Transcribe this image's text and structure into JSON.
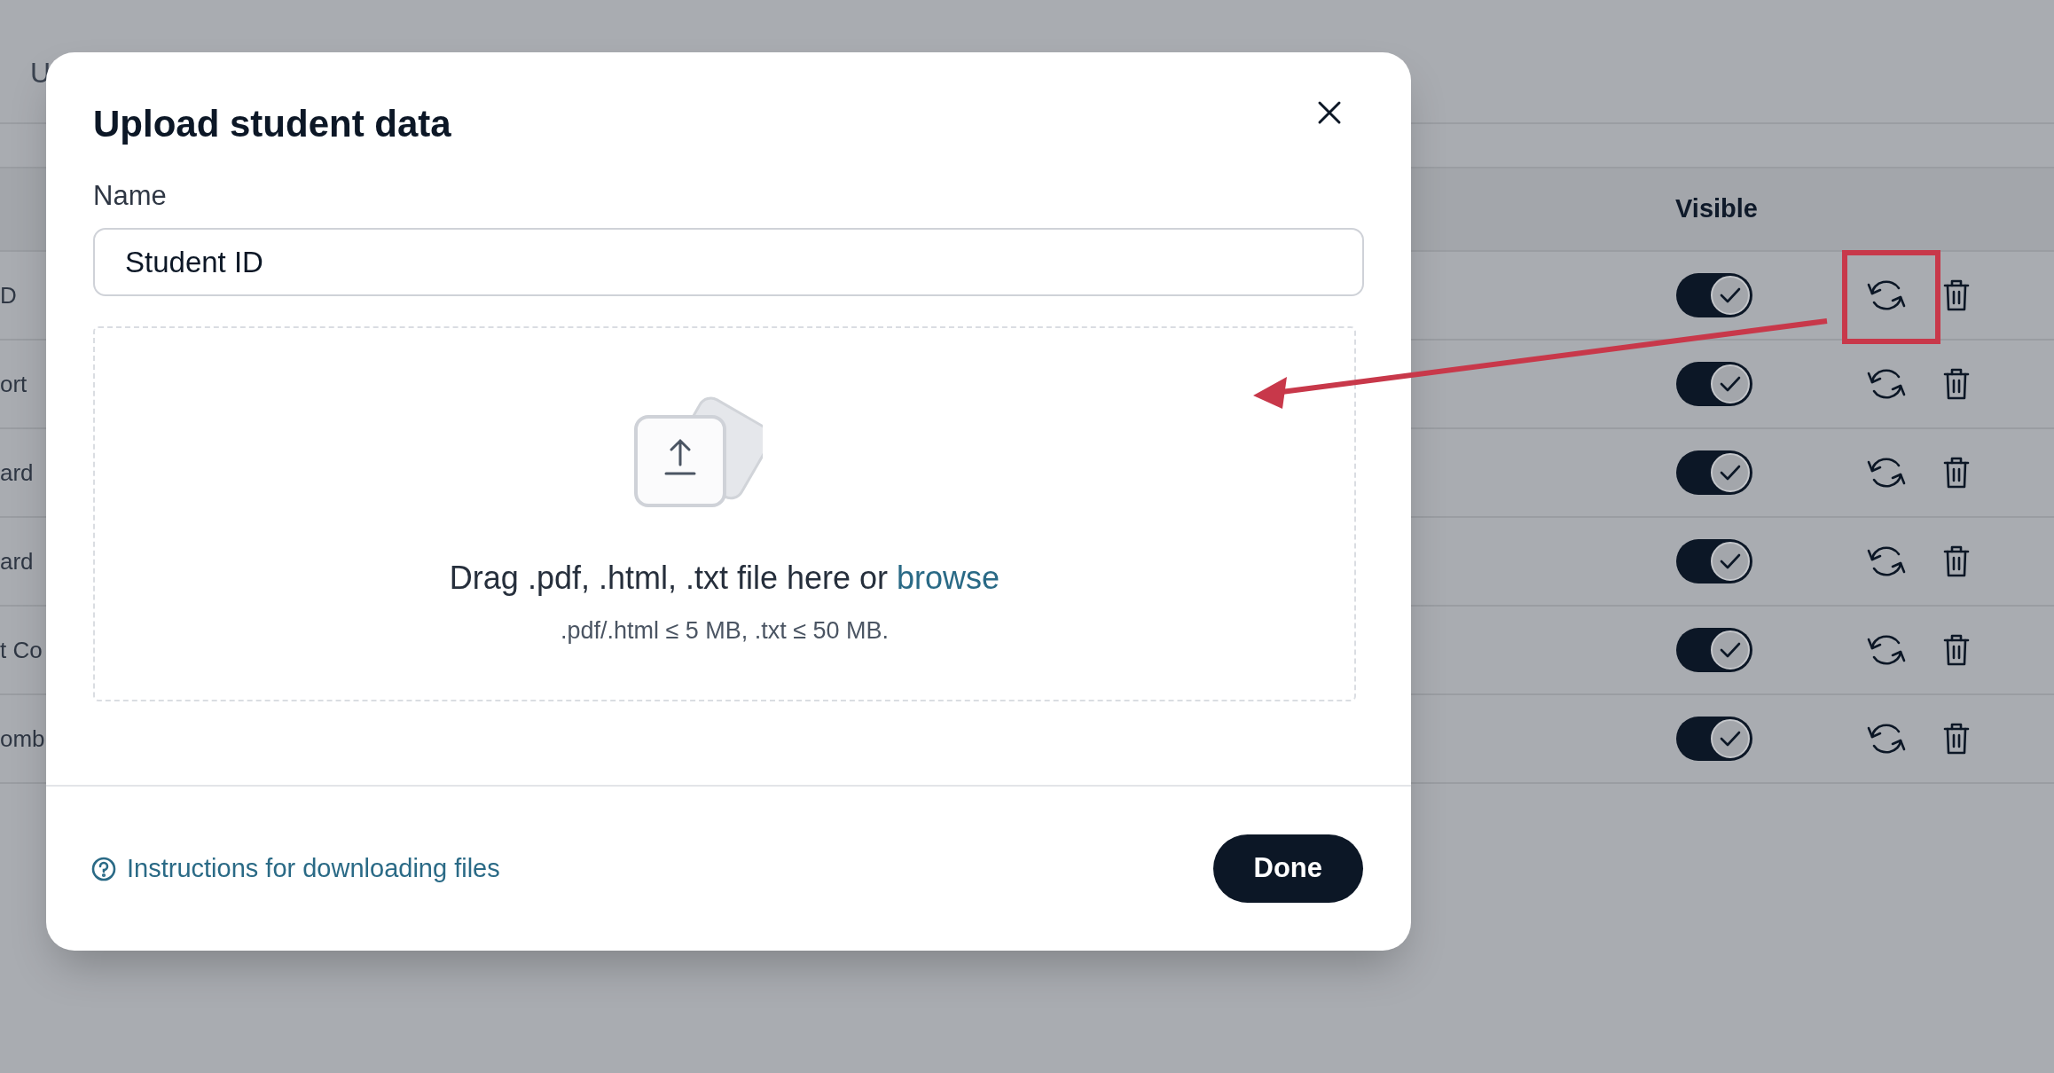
{
  "background": {
    "header_fragment": "U",
    "column_header": "Visible",
    "rows": [
      {
        "label": "D",
        "visible": true,
        "highlighted": true
      },
      {
        "label": "ort",
        "visible": true,
        "highlighted": false
      },
      {
        "label": "ard",
        "visible": true,
        "highlighted": false
      },
      {
        "label": "ard",
        "visible": true,
        "highlighted": false
      },
      {
        "label": "t Co",
        "visible": true,
        "highlighted": false
      },
      {
        "label": "omb",
        "visible": true,
        "highlighted": false
      }
    ]
  },
  "modal": {
    "title": "Upload student data",
    "name_label": "Name",
    "name_value": "Student ID",
    "dropzone": {
      "prompt": "Drag .pdf, .html, .txt file here or",
      "link": "browse",
      "limits": ".pdf/.html ≤ 5 MB, .txt ≤ 50 MB."
    },
    "help_link": "Instructions for downloading files",
    "done_button": "Done"
  }
}
